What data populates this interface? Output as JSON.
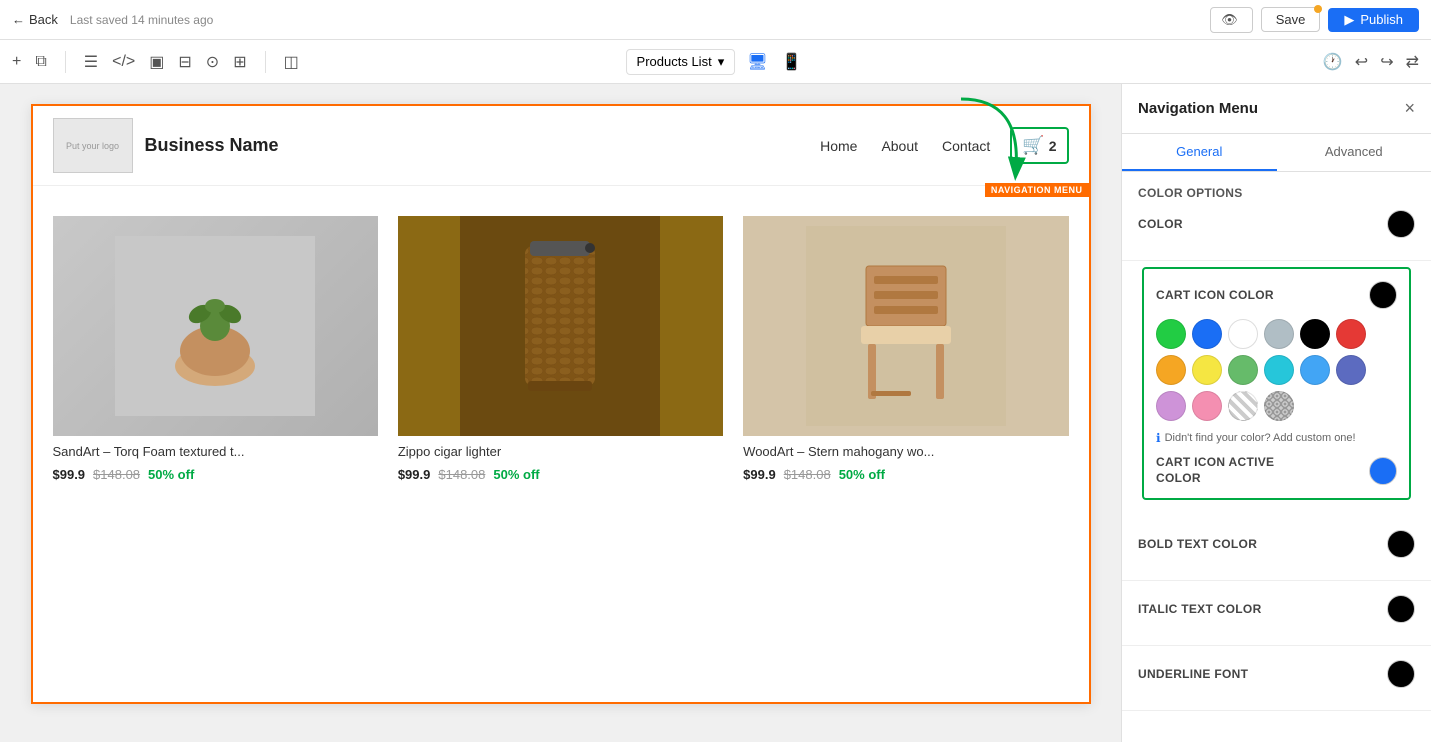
{
  "topbar": {
    "back_label": "Back",
    "save_status": "Last saved 14 minutes ago",
    "preview_label": "Preview",
    "save_label": "Save",
    "publish_label": "Publish",
    "has_unsaved_dot": true
  },
  "toolbar": {
    "page_selector": {
      "label": "Products List",
      "chevron": "▾"
    },
    "device_desktop": "🖥",
    "device_mobile": "📱"
  },
  "canvas": {
    "nav": {
      "logo_placeholder": "Put your logo",
      "business_name": "Business Name",
      "links": [
        "Home",
        "About",
        "Contact"
      ],
      "cart_count": "2",
      "nav_badge": "NAVIGATION MENU"
    },
    "products": [
      {
        "name": "SandArt – Torq Foam textured t...",
        "price": "$99.9",
        "original": "$148.08",
        "discount": "50% off",
        "img_type": "plant"
      },
      {
        "name": "Zippo cigar lighter",
        "price": "$99.9",
        "original": "$148.08",
        "discount": "50% off",
        "img_type": "lighter"
      },
      {
        "name": "WoodArt – Stern mahogany wo...",
        "price": "$99.9",
        "original": "$148.08",
        "discount": "50% off",
        "img_type": "chair"
      }
    ]
  },
  "right_panel": {
    "title": "Navigation Menu",
    "close_label": "×",
    "tabs": [
      "General",
      "Advanced"
    ],
    "active_tab": "General",
    "sections": {
      "color_options": {
        "title": "Color Options",
        "color_label": "COLOR",
        "color_value": "#000000"
      },
      "cart_icon_color": {
        "title": "CART ICON COLOR",
        "current_color": "#000000",
        "palette": [
          {
            "color": "#22cc44",
            "name": "green"
          },
          {
            "color": "#1a6ef5",
            "name": "blue"
          },
          {
            "color": "#ffffff",
            "name": "white"
          },
          {
            "color": "#b0bec5",
            "name": "light-gray"
          },
          {
            "color": "#000000",
            "name": "black"
          },
          {
            "color": "#e53935",
            "name": "red"
          },
          {
            "color": "#f5a623",
            "name": "orange"
          },
          {
            "color": "#f5e642",
            "name": "yellow"
          },
          {
            "color": "#66bb6a",
            "name": "light-green"
          },
          {
            "color": "#26c6da",
            "name": "cyan"
          },
          {
            "color": "#42a5f5",
            "name": "sky-blue"
          },
          {
            "color": "#5c6bc0",
            "name": "indigo"
          },
          {
            "color": "#ce93d8",
            "name": "lavender"
          },
          {
            "color": "#f48fb1",
            "name": "pink"
          },
          {
            "color": "transparent",
            "name": "transparent"
          },
          {
            "color": "gray-pattern",
            "name": "gray-pattern"
          }
        ],
        "custom_color_hint": "Didn't find your color? Add custom one!",
        "active_label": "CART ICON ACTIVE\nCOLOR",
        "active_color": "#1a6ef5"
      },
      "bold_text": {
        "label": "BOLD TEXT COLOR",
        "color": "#000000"
      },
      "italic_text": {
        "label": "ITALIC TEXT COLOR",
        "color": "#000000"
      },
      "underline_text": {
        "label": "UNDERLINE FONT",
        "color": "#000000"
      }
    }
  }
}
